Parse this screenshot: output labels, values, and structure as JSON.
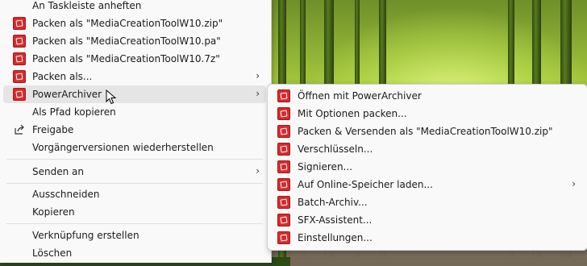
{
  "context_menu": {
    "items": [
      {
        "label": "An Taskleiste anheften",
        "icon": null
      },
      {
        "label": "Packen als \"MediaCreationToolW10.zip\"",
        "icon": "powerarchiver-icon"
      },
      {
        "label": "Packen als \"MediaCreationToolW10.pa\"",
        "icon": "powerarchiver-icon"
      },
      {
        "label": "Packen als \"MediaCreationToolW10.7z\"",
        "icon": "powerarchiver-icon"
      },
      {
        "label": "Packen als...",
        "icon": "powerarchiver-icon",
        "submenu": true
      },
      {
        "label": "PowerArchiver",
        "icon": "powerarchiver-icon",
        "submenu": true,
        "hovered": true
      },
      {
        "label": "Als Pfad kopieren",
        "icon": null
      },
      {
        "label": "Freigabe",
        "icon": "share-icon"
      },
      {
        "label": "Vorgängerversionen wiederherstellen",
        "icon": null
      },
      {
        "label": "Senden an",
        "icon": null,
        "submenu": true
      },
      {
        "label": "Ausschneiden",
        "icon": null
      },
      {
        "label": "Kopieren",
        "icon": null
      },
      {
        "label": "Verknüpfung erstellen",
        "icon": null
      },
      {
        "label": "Löschen",
        "icon": null
      }
    ],
    "chevron": "›"
  },
  "submenu": {
    "items": [
      {
        "label": "Öffnen mit PowerArchiver",
        "icon": "powerarchiver-icon"
      },
      {
        "label": "Mit Optionen packen...",
        "icon": "powerarchiver-icon"
      },
      {
        "label": "Packen & Versenden als \"MediaCreationToolW10.zip\"",
        "icon": "powerarchiver-icon"
      },
      {
        "label": "Verschlüsseln...",
        "icon": "powerarchiver-icon"
      },
      {
        "label": "Signieren...",
        "icon": "powerarchiver-icon"
      },
      {
        "label": "Auf Online-Speicher laden...",
        "icon": "powerarchiver-icon",
        "submenu": true
      },
      {
        "label": "Batch-Archiv...",
        "icon": "powerarchiver-icon"
      },
      {
        "label": "SFX-Assistent...",
        "icon": "powerarchiver-icon"
      },
      {
        "label": "Einstellungen...",
        "icon": "powerarchiver-icon"
      }
    ]
  },
  "colors": {
    "icon_red": "#d62b2b",
    "hover": "#e5e5e5",
    "menu_bg": "#f9f9f9"
  }
}
